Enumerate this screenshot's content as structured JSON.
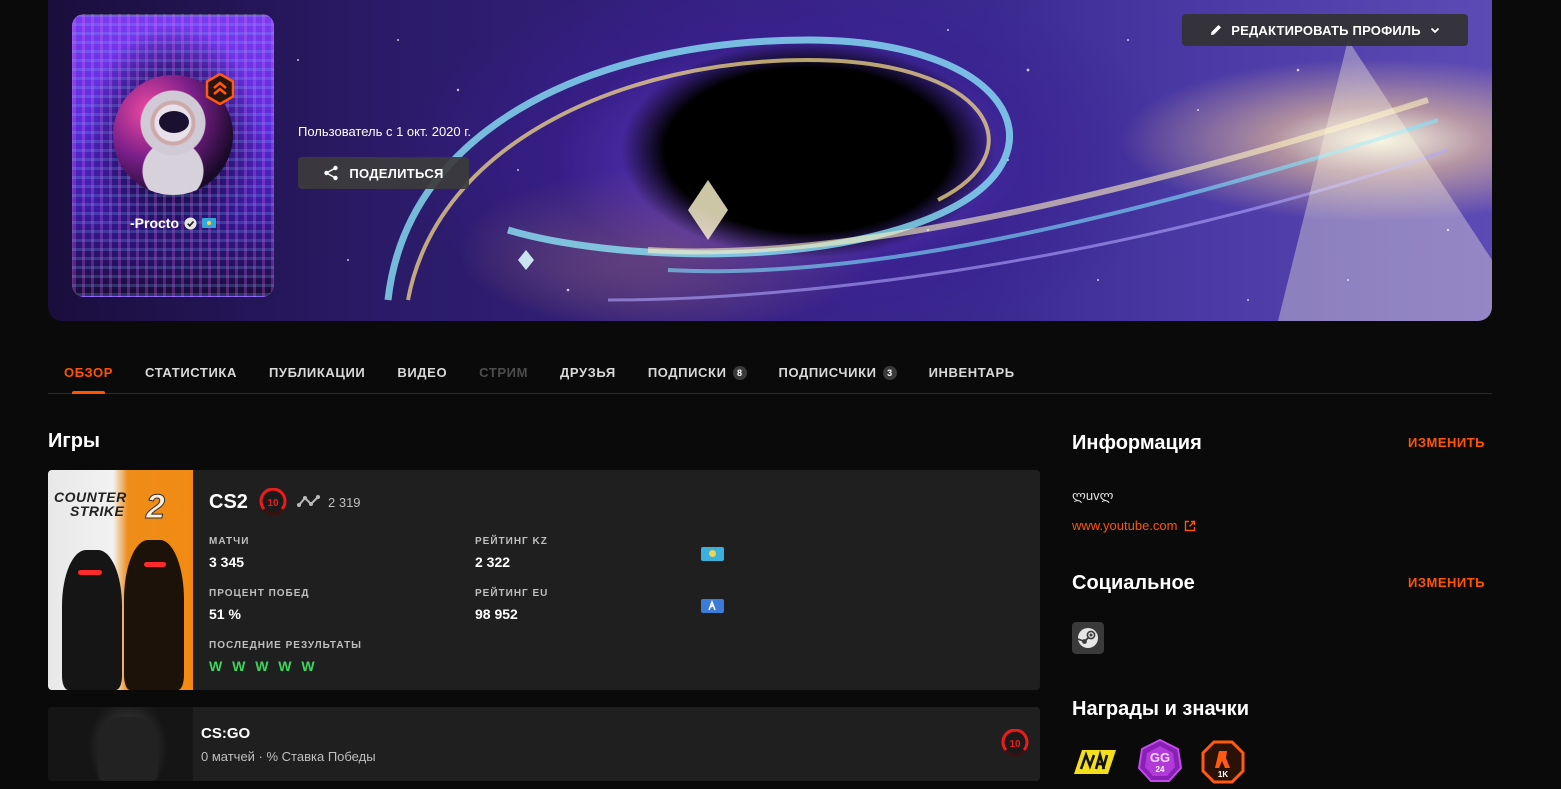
{
  "profile": {
    "username": "-Procto",
    "member_since": "Пользователь с 1 окт. 2020 г.",
    "share_label": "ПОДЕЛИТЬСЯ",
    "edit_profile_label": "РЕДАКТИРОВАТЬ ПРОФИЛЬ",
    "icons": {
      "verified": "verified-icon",
      "country": "flag-kz-icon",
      "level": "level-chevron-icon"
    }
  },
  "tabs": [
    {
      "label": "ОБЗОР",
      "state": "active"
    },
    {
      "label": "СТАТИСТИКА"
    },
    {
      "label": "ПУБЛИКАЦИИ"
    },
    {
      "label": "ВИДЕО"
    },
    {
      "label": "СТРИМ",
      "state": "disabled"
    },
    {
      "label": "ДРУЗЬЯ"
    },
    {
      "label": "ПОДПИСКИ",
      "count": "8"
    },
    {
      "label": "ПОДПИСЧИКИ",
      "count": "3"
    },
    {
      "label": "ИНВЕНТАРЬ"
    }
  ],
  "games": {
    "title": "Игры",
    "cs2": {
      "name": "CS2",
      "level": "10",
      "elo": "2 319",
      "art_logo_line1": "COUNTER",
      "art_logo_line2": "STRIKE",
      "art_logo_num": "2",
      "matches_label": "МАТЧИ",
      "matches_value": "3 345",
      "rating_kz_label": "РЕЙТИНГ KZ",
      "rating_kz_value": "2 322",
      "winrate_label": "ПРОЦЕНТ ПОБЕД",
      "winrate_value": "51 %",
      "rating_eu_label": "РЕЙТИНГ EU",
      "rating_eu_value": "98 952",
      "recent_label": "ПОСЛЕДНИЕ РЕЗУЛЬТАТЫ",
      "recent_value": "W W W W W"
    },
    "csgo": {
      "name": "CS:GO",
      "subtitle": "0 матчей · % Ставка Победы",
      "level": "10"
    }
  },
  "info": {
    "title": "Информация",
    "edit_label": "ИЗМЕНИТЬ",
    "bio": "ლuvლ",
    "link": "www.youtube.com"
  },
  "social": {
    "title": "Социальное",
    "edit_label": "ИЗМЕНИТЬ",
    "accounts": [
      "steam-icon"
    ]
  },
  "awards": {
    "title": "Награды и значки",
    "badges": [
      "navi-badge",
      "gg-24-badge",
      "1k-badge"
    ],
    "gg_text": "GG",
    "gg_num": "24",
    "k_text": "1K"
  },
  "colors": {
    "accent": "#ff5500",
    "win": "#3dd65c",
    "card": "#1f1f1f",
    "background": "#0a0a0a"
  }
}
